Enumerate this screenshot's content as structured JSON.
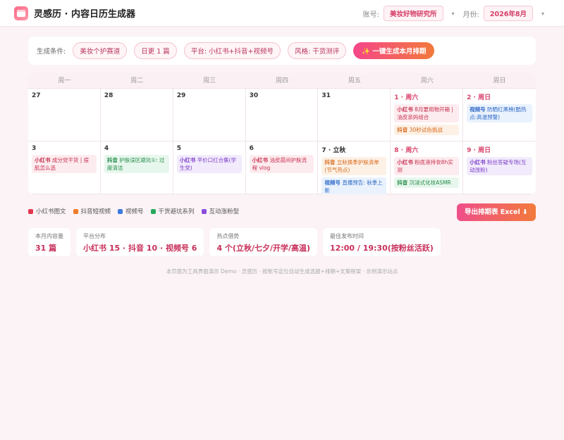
{
  "header": {
    "title": "灵感历 · 内容日历生成器",
    "account_label": "账号:",
    "account_value": "美妆好物研究所",
    "month_label": "月份:",
    "month_value": "2026年8月",
    "caret": "▾"
  },
  "conditions": {
    "label": "生成条件:",
    "pills": [
      "美妆个护赛道",
      "日更 1 篇",
      "平台: 小红书+抖音+视频号",
      "风格: 干货测评"
    ],
    "generate_button": "✨ 一键生成本月排期"
  },
  "calendar": {
    "weekdays": [
      "周一",
      "周二",
      "周三",
      "周四",
      "周五",
      "周六",
      "周日"
    ],
    "days": [
      {
        "label": "27",
        "weekend": false,
        "events": []
      },
      {
        "label": "28",
        "weekend": false,
        "events": []
      },
      {
        "label": "29",
        "weekend": false,
        "events": []
      },
      {
        "label": "30",
        "weekend": false,
        "events": []
      },
      {
        "label": "31",
        "weekend": false,
        "events": []
      },
      {
        "label": "1 · 周六",
        "weekend": true,
        "events": [
          {
            "color": "red",
            "platform": "小红书",
            "text": "8月要用物开箱 | 油皮亲妈组合"
          },
          {
            "color": "orange",
            "platform": "抖音",
            "text": "30秒试色挑战"
          }
        ]
      },
      {
        "label": "2 · 周日",
        "weekend": true,
        "events": [
          {
            "color": "blue",
            "platform": "视频号",
            "text": "防晒红黑榜(酷热点:高温预警)"
          }
        ]
      },
      {
        "label": "3",
        "weekend": false,
        "events": [
          {
            "color": "red",
            "platform": "小红书",
            "text": "成分党干货 | 痘肌怎么选"
          }
        ]
      },
      {
        "label": "4",
        "weekend": false,
        "events": [
          {
            "color": "green",
            "platform": "抖音",
            "text": "护肤误区避坑①: 过度清洁"
          }
        ]
      },
      {
        "label": "5",
        "weekend": false,
        "events": [
          {
            "color": "purple",
            "platform": "小红书",
            "text": "平价口红合集(学生党)"
          }
        ]
      },
      {
        "label": "6",
        "weekend": false,
        "events": [
          {
            "color": "red",
            "platform": "小红书",
            "text": "油皮晨间护肤流程 vlog"
          }
        ]
      },
      {
        "label": "7 · 立秋",
        "weekend": false,
        "events": [
          {
            "color": "orange",
            "platform": "抖音",
            "text": "立秋换季护肤清单(节气热点)"
          },
          {
            "color": "blue",
            "platform": "视频号",
            "text": "直播预告: 秋季上新"
          }
        ]
      },
      {
        "label": "8 · 周六",
        "weekend": true,
        "events": [
          {
            "color": "red",
            "platform": "小红书",
            "text": "粉底液持妆8h实测"
          },
          {
            "color": "green",
            "platform": "抖音",
            "text": "沉浸式化妆ASMR"
          }
        ]
      },
      {
        "label": "9 · 周日",
        "weekend": true,
        "events": [
          {
            "color": "purple",
            "platform": "小红书",
            "text": "粉丝答疑专场(互动涨粉)"
          }
        ]
      }
    ]
  },
  "legend": [
    {
      "label": "小红书图文",
      "color": "#e5354f"
    },
    {
      "label": "抖音短视频",
      "color": "#f07b2a"
    },
    {
      "label": "视频号",
      "color": "#3b7ae0"
    },
    {
      "label": "干货避坑系列",
      "color": "#26a85a"
    },
    {
      "label": "互动涨粉型",
      "color": "#8a4ddb"
    }
  ],
  "export_button": "导出排期表 Excel ⬇",
  "stats": [
    {
      "label": "本月内容量",
      "value": "31 篇"
    },
    {
      "label": "平台分布",
      "value": "小红书 15 · 抖音 10 · 视频号 6"
    },
    {
      "label": "热点借势",
      "value": "4 个(立秋/七夕/开学/高温)"
    },
    {
      "label": "最佳发布时间",
      "value": "12:00 / 19:30(按粉丝活跃)"
    }
  ],
  "footer": "本页面为工具界面演示 Demo · 灵感历 · 按账号定位自动生成选题+排期+文案框架 · 示例演示站点"
}
